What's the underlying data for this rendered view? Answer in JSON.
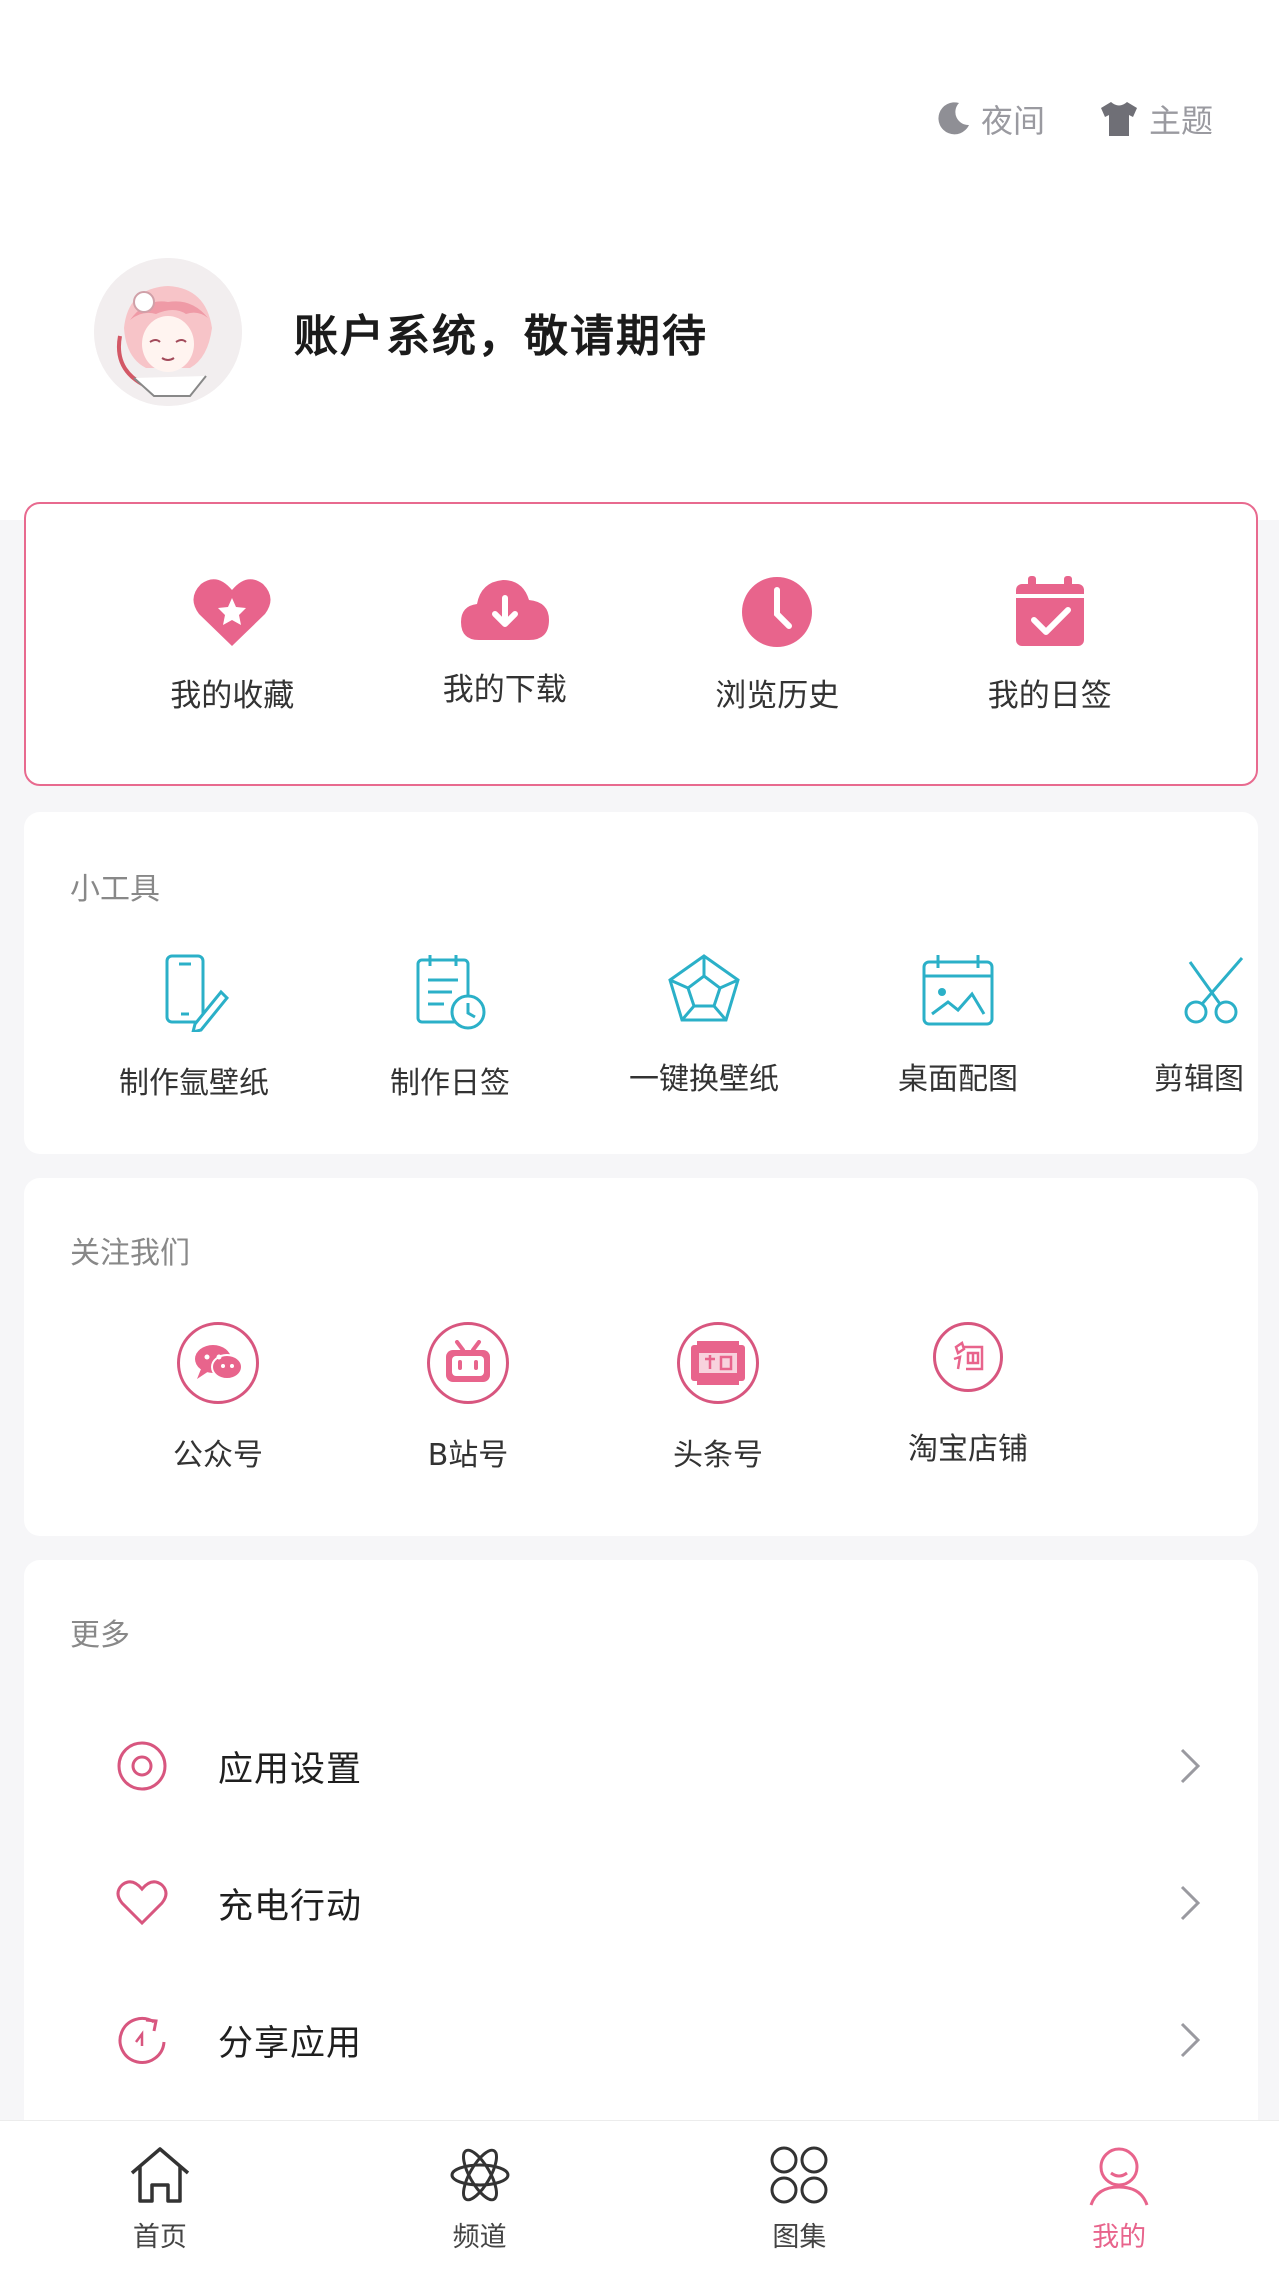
{
  "header": {
    "night_label": "夜间",
    "theme_label": "主题"
  },
  "profile": {
    "name": "账户系统，敬请期待"
  },
  "quick_actions": [
    {
      "label": "我的收藏",
      "icon": "heart-icon"
    },
    {
      "label": "我的下载",
      "icon": "cloud-download-icon"
    },
    {
      "label": "浏览历史",
      "icon": "clock-icon"
    },
    {
      "label": "我的日签",
      "icon": "calendar-check-icon"
    }
  ],
  "tools": {
    "title": "小工具",
    "items": [
      {
        "label": "制作氩壁纸",
        "icon": "phone-edit-icon"
      },
      {
        "label": "制作日签",
        "icon": "document-clock-icon"
      },
      {
        "label": "一键换壁纸",
        "icon": "pentagon-icon"
      },
      {
        "label": "桌面配图",
        "icon": "picture-calendar-icon"
      },
      {
        "label": "剪辑图",
        "icon": "scissors-icon"
      }
    ]
  },
  "follow": {
    "title": "关注我们",
    "items": [
      {
        "label": "公众号",
        "icon": "wechat-icon"
      },
      {
        "label": "B站号",
        "icon": "bilibili-icon"
      },
      {
        "label": "头条号",
        "icon": "toutiao-icon"
      },
      {
        "label": "淘宝店铺",
        "icon": "taobao-icon"
      }
    ]
  },
  "more": {
    "title": "更多",
    "items": [
      {
        "label": "应用设置",
        "icon": "settings-circle-icon"
      },
      {
        "label": "充电行动",
        "icon": "heart-outline-icon"
      },
      {
        "label": "分享应用",
        "icon": "refresh-icon"
      }
    ]
  },
  "bottom_nav": [
    {
      "label": "首页",
      "icon": "home-icon",
      "active": false
    },
    {
      "label": "频道",
      "icon": "atom-icon",
      "active": false
    },
    {
      "label": "图集",
      "icon": "grid-icon",
      "active": false
    },
    {
      "label": "我的",
      "icon": "user-icon",
      "active": true
    }
  ],
  "colors": {
    "accent": "#e8648c",
    "tool_icon": "#2bb0c8",
    "quick_border": "#e86a8f"
  }
}
